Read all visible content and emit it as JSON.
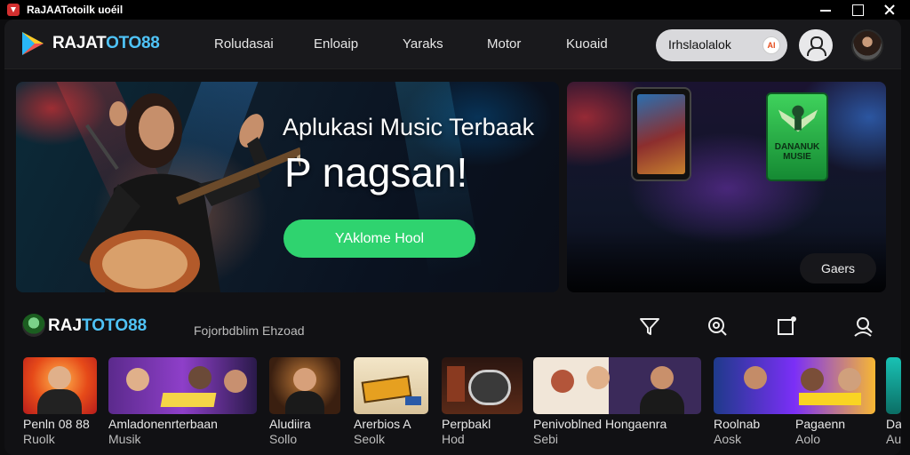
{
  "window": {
    "title": "RaJAATotoilk uoéil"
  },
  "nav": {
    "brand": {
      "part1": "RAJAT",
      "part2": "OTO88"
    },
    "links": [
      "Roludasai",
      "Enloaip",
      "Yaraks",
      "Motor",
      "Kuoaid"
    ],
    "search": {
      "value": "Irhslaolalok",
      "badge": "AI"
    }
  },
  "hero": {
    "title": "Aplukasi Music Terbaak",
    "subtitle": "P nagsan!",
    "cta": "YAklome Hool"
  },
  "promo": {
    "phone_text": "DANANUK MUSIE",
    "button": "Gaers"
  },
  "section": {
    "brand": {
      "part1": "RAJ",
      "part2": "TOTO88"
    },
    "subtitle": "Fojorbdblim Ehzoad"
  },
  "cards": [
    {
      "title": "Penln 08  88",
      "sub": "Ruolk"
    },
    {
      "title": "Amladonenrterbaan",
      "sub": "Musik"
    },
    {
      "title": "Aludiira",
      "sub": "Sollo"
    },
    {
      "title": "Arerbios    A",
      "sub": "Seolk"
    },
    {
      "title": "Perpbakl",
      "sub": "Hod"
    },
    {
      "title": "Penivoblned Hongaenra",
      "sub": "Sebi"
    },
    {
      "title": "Roolnab",
      "sub": "Aosk"
    },
    {
      "title": "Pagaenn",
      "sub": "Aolo"
    },
    {
      "title": "Da",
      "sub": "Au"
    }
  ]
}
